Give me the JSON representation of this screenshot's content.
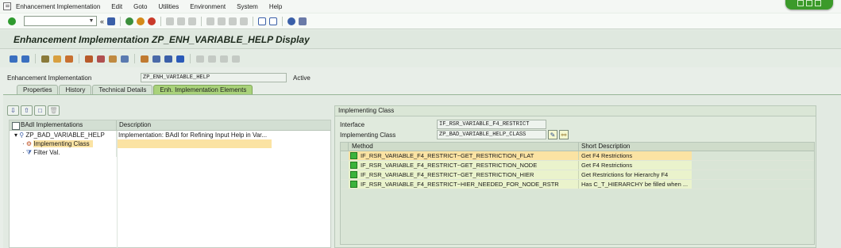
{
  "menu": {
    "items": [
      {
        "label": "Enhancement Implementation",
        "name": "menu-enhancement-implementation"
      },
      {
        "label": "Edit",
        "name": "menu-edit"
      },
      {
        "label": "Goto",
        "name": "menu-goto"
      },
      {
        "label": "Utilities",
        "name": "menu-utilities"
      },
      {
        "label": "Environment",
        "name": "menu-environment"
      },
      {
        "label": "System",
        "name": "menu-system"
      },
      {
        "label": "Help",
        "name": "menu-help"
      }
    ]
  },
  "title": "Enhancement Implementation ZP_ENH_VARIABLE_HELP Display",
  "header": {
    "label": "Enhancement Implementation",
    "value": "ZP_ENH_VARIABLE_HELP",
    "status": "Active"
  },
  "tabs": [
    {
      "label": "Properties",
      "active": false
    },
    {
      "label": "History",
      "active": false
    },
    {
      "label": "Technical Details",
      "active": false
    },
    {
      "label": "Enh. Implementation Elements",
      "active": true
    }
  ],
  "tree": {
    "col1": "BAdI Implementations",
    "col2": "Description",
    "rows": [
      {
        "text": "ZP_BAD_VARIABLE_HELP",
        "desc": "Implementation: BAdI for Refining Input Help in Var..."
      },
      {
        "text": "Implementing Class",
        "desc": ""
      },
      {
        "text": "Filter Val.",
        "desc": ""
      }
    ]
  },
  "right_panel": {
    "title": "Implementing Class",
    "interface_label": "Interface",
    "interface_value": "IF_RSR_VARIABLE_F4_RESTRICT",
    "class_label": "Implementing Class",
    "class_value": "ZP_BAD_VARIABLE_HELP_CLASS",
    "grid": {
      "col_method": "Method",
      "col_desc": "Short Description",
      "rows": [
        {
          "method": "IF_RSR_VARIABLE_F4_RESTRICT~GET_RESTRICTION_FLAT",
          "desc": "Get F4 Restrictions"
        },
        {
          "method": "IF_RSR_VARIABLE_F4_RESTRICT~GET_RESTRICTION_NODE",
          "desc": "Get F4 Restrictions"
        },
        {
          "method": "IF_RSR_VARIABLE_F4_RESTRICT~GET_RESTRICTION_HIER",
          "desc": "Get Restrictions for Hierarchy F4"
        },
        {
          "method": "IF_RSR_VARIABLE_F4_RESTRICT~HIER_NEEDED_FOR_NODE_RSTR",
          "desc": "Has C_T_HIERARCHY be filled when ..."
        }
      ]
    }
  },
  "colors": {
    "active_tab": "#a9d27a",
    "selection": "#fbe3a3",
    "status_green": "#3cb33c",
    "window_green": "#3b9a2a"
  }
}
